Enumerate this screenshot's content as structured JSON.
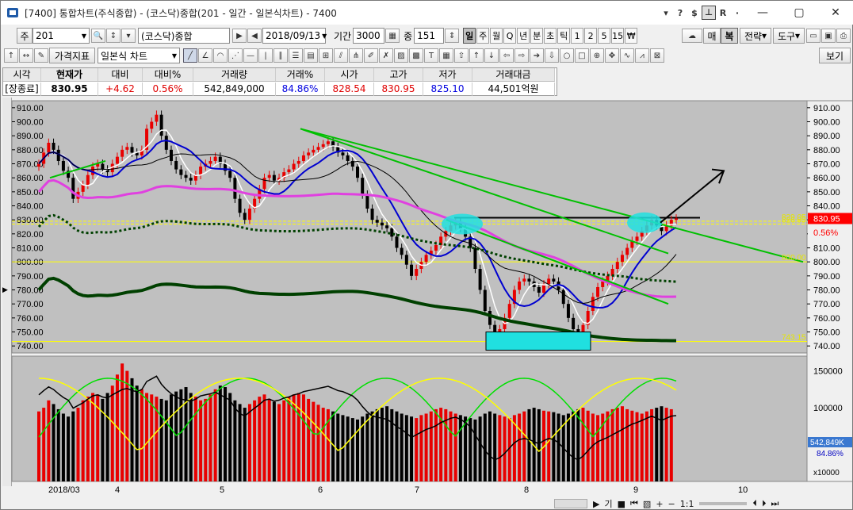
{
  "window": {
    "title": "[7400] 통합차트(주식종합) - (코스닥)종합(201 - 일간 - 일본식차트) - 7400",
    "tb_controls": [
      "▾",
      "?",
      "$",
      "⊥",
      "R",
      "·"
    ],
    "win_buttons": [
      "—",
      "▢",
      "✕"
    ]
  },
  "toolbar1": {
    "market_btn": "주",
    "code_value": "201",
    "name_value": "(코스닥)종합",
    "date_value": "2018/09/13",
    "period_label": "기간",
    "period_value": "3000",
    "count_label": "종",
    "count_value": "151",
    "periods": [
      "일",
      "주",
      "월",
      "Q",
      "년",
      "분",
      "초",
      "틱",
      "1",
      "2",
      "5",
      "15",
      "₩"
    ],
    "selected_period": "일",
    "buy_label": "매",
    "sell_label": "복",
    "strategy_label": "전략",
    "tools_label": "도구"
  },
  "toolbar2": {
    "indicator_btn": "가격지표",
    "chart_type_value": "일본식 차트",
    "view_btn": "보기"
  },
  "quote": {
    "headers": [
      "시각",
      "현재가",
      "대비",
      "대비%",
      "거래량",
      "거래%",
      "시가",
      "고가",
      "저가",
      "거래대금"
    ],
    "values": [
      "[장종료]",
      "830.95",
      "+4.62",
      "0.56%",
      "542,849,000",
      "84.86%",
      "828.54",
      "830.95",
      "825.10",
      "44,501억원"
    ]
  },
  "chart_data": {
    "type": "line",
    "price_axis": {
      "ylim": [
        735,
        915
      ],
      "ticks": [
        "910.00",
        "900.00",
        "890.00",
        "880.00",
        "870.00",
        "860.00",
        "850.00",
        "840.00",
        "830.00",
        "820.00",
        "810.00",
        "800.00",
        "790.00",
        "780.00",
        "770.00",
        "760.00",
        "750.00",
        "740.00"
      ]
    },
    "price_labels": {
      "current": "830.95",
      "change_pct": "0.56%",
      "hline_a": "829.05",
      "hline_b": "826.95",
      "level_800": "800.00",
      "level_743": "743.15"
    },
    "volume_axis": {
      "ticks": [
        "150000",
        "100000"
      ],
      "current_volume": "542,849K",
      "ratio": "84.86%",
      "multiplier": "x10000"
    },
    "x_axis": {
      "labels": [
        "2018/03",
        "4",
        "5",
        "6",
        "7",
        "8",
        "9",
        "10"
      ]
    },
    "ohlc_series_approx": [
      870,
      878,
      885,
      880,
      872,
      865,
      860,
      845,
      850,
      855,
      862,
      868,
      870,
      866,
      864,
      870,
      875,
      880,
      882,
      878,
      876,
      880,
      895,
      900,
      905,
      890,
      880,
      872,
      866,
      862,
      860,
      858,
      862,
      868,
      870,
      872,
      875,
      870,
      865,
      860,
      845,
      835,
      830,
      838,
      845,
      852,
      860,
      862,
      858,
      860,
      864,
      866,
      870,
      872,
      876,
      878,
      880,
      882,
      884,
      886,
      882,
      878,
      876,
      872,
      868,
      860,
      848,
      838,
      830,
      828,
      826,
      824,
      818,
      810,
      805,
      798,
      790,
      795,
      800,
      805,
      808,
      812,
      818,
      822,
      826,
      828,
      824,
      818,
      810,
      795,
      780,
      765,
      755,
      748,
      752,
      760,
      770,
      780,
      786,
      788,
      786,
      782,
      778,
      784,
      788,
      786,
      780,
      770,
      760,
      752,
      748,
      755,
      765,
      775,
      782,
      786,
      790,
      795,
      800,
      805,
      810,
      815,
      818,
      822,
      826,
      830,
      826,
      822,
      826,
      830,
      831
    ],
    "volume_series_approx": [
      95,
      100,
      110,
      105,
      98,
      92,
      88,
      95,
      100,
      110,
      115,
      120,
      118,
      112,
      120,
      130,
      145,
      160,
      150,
      140,
      130,
      125,
      120,
      118,
      115,
      112,
      110,
      118,
      122,
      125,
      128,
      120,
      115,
      110,
      112,
      118,
      125,
      130,
      128,
      120,
      110,
      105,
      100,
      105,
      110,
      115,
      118,
      112,
      108,
      105,
      110,
      115,
      118,
      120,
      118,
      112,
      108,
      104,
      100,
      98,
      95,
      92,
      90,
      88,
      86,
      84,
      88,
      92,
      95,
      98,
      100,
      102,
      98,
      95,
      92,
      90,
      88,
      86,
      90,
      92,
      95,
      98,
      100,
      98,
      95,
      92,
      90,
      88,
      86,
      84,
      88,
      92,
      95,
      92,
      90,
      88,
      86,
      90,
      92,
      95,
      98,
      100,
      98,
      96,
      95,
      94,
      92,
      90,
      92,
      95,
      98,
      100,
      96,
      92,
      90,
      92,
      95,
      98,
      100,
      102,
      98,
      96,
      94,
      92,
      95,
      98,
      100,
      102,
      100,
      98
    ]
  },
  "colors": {
    "chart_bg": "#c0c0c0",
    "up": "#e80000",
    "down": "#000000",
    "ma_pink": "#e040e0",
    "ma_blue": "#0000d0",
    "ma_white": "#ffffff",
    "ma_green": "#00c000",
    "ma_darkgreen": "#004000",
    "ichimoku": "#000000",
    "highlight_cyan": "#20e0e0",
    "hline_yellow": "#ffff00",
    "volume_yellow": "#ffff00"
  }
}
